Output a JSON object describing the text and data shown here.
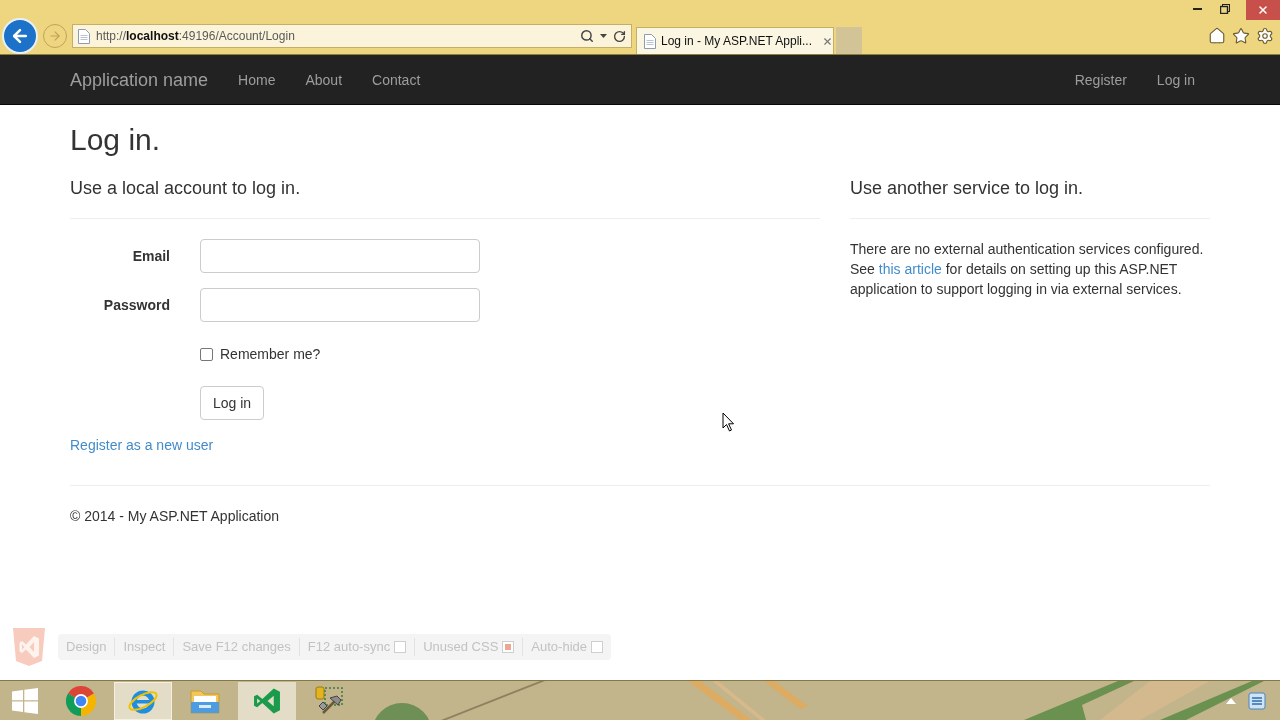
{
  "browser": {
    "address": "http://**localhost**:49196/Account/Login",
    "tab": {
      "title": "Log in - My ASP.NET Appli..."
    }
  },
  "navbar": {
    "brand": "Application name",
    "links": [
      "Home",
      "About",
      "Contact"
    ],
    "right_links": [
      "Register",
      "Log in"
    ]
  },
  "page": {
    "title": "Log in.",
    "local": {
      "heading": "Use a local account to log in.",
      "fields": [
        {
          "label": "Email"
        },
        {
          "label": "Password"
        }
      ],
      "remember": {
        "label": "Remember me?",
        "checked": false
      },
      "submit": "Log in",
      "register_link": "Register as a new user"
    },
    "external": {
      "heading": "Use another service to log in.",
      "text_before": "There are no external authentication services configured. See",
      "link": "this article",
      "text_after": "for details on setting up this ASP.NET application to support logging in via external services."
    },
    "footer": "© 2014 - My ASP.NET Application"
  },
  "browser_link": {
    "items": [
      {
        "kind": "button",
        "label": "Design"
      },
      {
        "kind": "button",
        "label": "Inspect"
      },
      {
        "kind": "button",
        "label": "Save F12 changes"
      },
      {
        "kind": "checkbox",
        "label": "F12 auto-sync",
        "checked": false
      },
      {
        "kind": "checkbox",
        "label": "Unused CSS",
        "checked": true
      },
      {
        "kind": "checkbox",
        "label": "Auto-hide",
        "checked": false
      }
    ]
  },
  "taskbar": {
    "apps": [
      {
        "kind": "chrome",
        "running": false,
        "active": false
      },
      {
        "kind": "ie",
        "running": true,
        "active": true
      },
      {
        "kind": "explorer",
        "running": false,
        "active": false
      },
      {
        "kind": "visual-studio",
        "running": true,
        "active": false
      },
      {
        "kind": "tools",
        "running": false,
        "active": false
      }
    ]
  }
}
